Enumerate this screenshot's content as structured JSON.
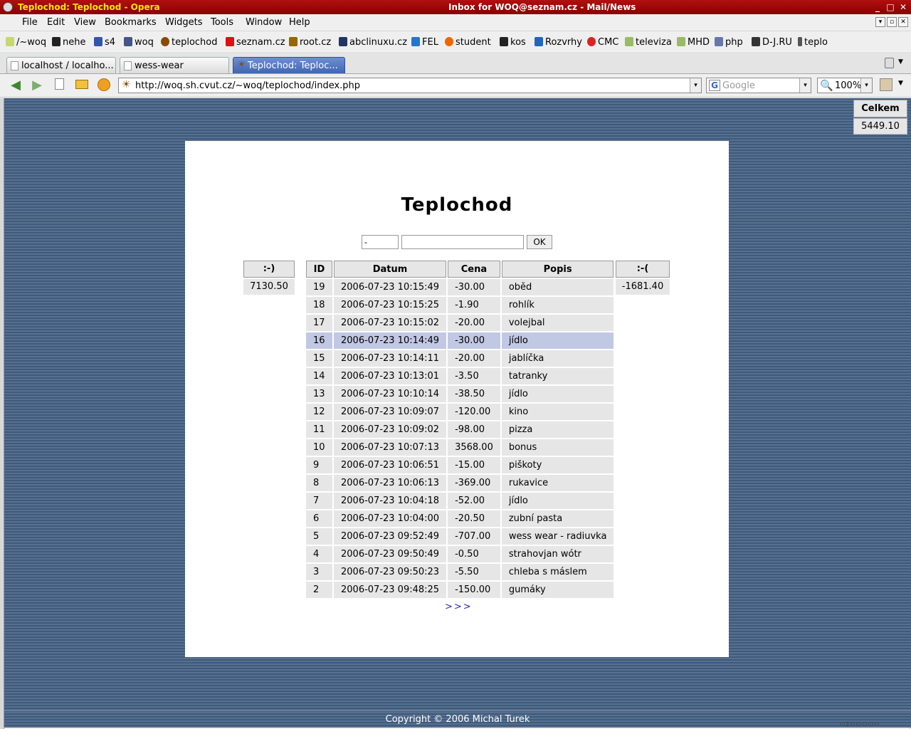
{
  "window": {
    "title": "Teplochod: Teplochod - Opera",
    "mail_title": "Inbox for WOQ@seznam.cz - Mail/News",
    "btn_min": "_",
    "btn_max": "□",
    "btn_close": "✕"
  },
  "menu": {
    "items": [
      "File",
      "Edit",
      "View",
      "Bookmarks",
      "Widgets",
      "Tools",
      "Window",
      "Help"
    ]
  },
  "bookmarks": [
    {
      "label": "/~woq",
      "color": "#c8d870"
    },
    {
      "label": "nehe",
      "color": "#222222"
    },
    {
      "label": "s4",
      "color": "#3355aa"
    },
    {
      "label": "woq",
      "color": "#445588"
    },
    {
      "label": "teplochod",
      "color": "#8a4a00"
    },
    {
      "label": "seznam.cz",
      "color": "#dd1111"
    },
    {
      "label": "root.cz",
      "color": "#996600"
    },
    {
      "label": "abclinuxu.cz",
      "color": "#223366"
    },
    {
      "label": "FEL",
      "color": "#2277cc"
    },
    {
      "label": "student",
      "color": "#ee6600"
    },
    {
      "label": "kos",
      "color": "#222222"
    },
    {
      "label": "Rozvrhy",
      "color": "#2266bb"
    },
    {
      "label": "CMC",
      "color": "#dd2222"
    },
    {
      "label": "televiza",
      "color": "#99bb66"
    },
    {
      "label": "MHD",
      "color": "#99bb66"
    },
    {
      "label": "php",
      "color": "#6677aa"
    },
    {
      "label": "D-J.RU",
      "color": "#333333"
    },
    {
      "label": "teplo",
      "color": "#555555"
    }
  ],
  "tabs": [
    {
      "label": "localhost / localho..."
    },
    {
      "label": "wess-wear"
    },
    {
      "label": "Teplochod: Teploc..."
    }
  ],
  "nav": {
    "url": "http://woq.sh.cvut.cz/~woq/teplochod/index.php",
    "search_placeholder": "Google",
    "zoom": "100%",
    "back_icon": "◀",
    "forward_icon": "▶",
    "dropdown_icon": "▾",
    "site_icon": "☀",
    "g_icon": "G",
    "zoom_icon": "🔍"
  },
  "page": {
    "title": "Teplochod",
    "form": {
      "small_value": "-",
      "ok_label": "OK"
    },
    "income": {
      "label": ":-)",
      "value": "7130.50"
    },
    "expense": {
      "label": ":-(",
      "value": "-1681.40"
    },
    "total": {
      "label": "Celkem",
      "value": "5449.10"
    },
    "columns": [
      "ID",
      "Datum",
      "Cena",
      "Popis"
    ],
    "rows": [
      {
        "id": "19",
        "date": "2006-07-23 10:15:49",
        "price": "-30.00",
        "desc": "oběd"
      },
      {
        "id": "18",
        "date": "2006-07-23 10:15:25",
        "price": "-1.90",
        "desc": "rohlík"
      },
      {
        "id": "17",
        "date": "2006-07-23 10:15:02",
        "price": "-20.00",
        "desc": "volejbal"
      },
      {
        "id": "16",
        "date": "2006-07-23 10:14:49",
        "price": "-30.00",
        "desc": "jídlo",
        "selected": true
      },
      {
        "id": "15",
        "date": "2006-07-23 10:14:11",
        "price": "-20.00",
        "desc": "jablíčka"
      },
      {
        "id": "14",
        "date": "2006-07-23 10:13:01",
        "price": "-3.50",
        "desc": "tatranky"
      },
      {
        "id": "13",
        "date": "2006-07-23 10:10:14",
        "price": "-38.50",
        "desc": "jídlo"
      },
      {
        "id": "12",
        "date": "2006-07-23 10:09:07",
        "price": "-120.00",
        "desc": "kino"
      },
      {
        "id": "11",
        "date": "2006-07-23 10:09:02",
        "price": "-98.00",
        "desc": "pizza"
      },
      {
        "id": "10",
        "date": "2006-07-23 10:07:13",
        "price": "3568.00",
        "desc": "bonus"
      },
      {
        "id": "9",
        "date": "2006-07-23 10:06:51",
        "price": "-15.00",
        "desc": "piškoty"
      },
      {
        "id": "8",
        "date": "2006-07-23 10:06:13",
        "price": "-369.00",
        "desc": "rukavice"
      },
      {
        "id": "7",
        "date": "2006-07-23 10:04:18",
        "price": "-52.00",
        "desc": "jídlo"
      },
      {
        "id": "6",
        "date": "2006-07-23 10:04:00",
        "price": "-20.50",
        "desc": "zubní pasta"
      },
      {
        "id": "5",
        "date": "2006-07-23 09:52:49",
        "price": "-707.00",
        "desc": "wess wear - radiuvka"
      },
      {
        "id": "4",
        "date": "2006-07-23 09:50:49",
        "price": "-0.50",
        "desc": "strahovjan wótr"
      },
      {
        "id": "3",
        "date": "2006-07-23 09:50:23",
        "price": "-5.50",
        "desc": "chleba s máslem"
      },
      {
        "id": "2",
        "date": "2006-07-23 09:48:25",
        "price": "-150.00",
        "desc": "gumáky"
      }
    ],
    "next_label": ">>>",
    "footer": "Copyright © 2006 Michal Turek"
  },
  "colors": {
    "titlebar": "#9a0000",
    "title_text": "#ffe600",
    "active_tab": "#4a6fbf",
    "page_bg": "#4a6585",
    "selected_row": "#c0c8e4",
    "link": "#2222cc"
  }
}
